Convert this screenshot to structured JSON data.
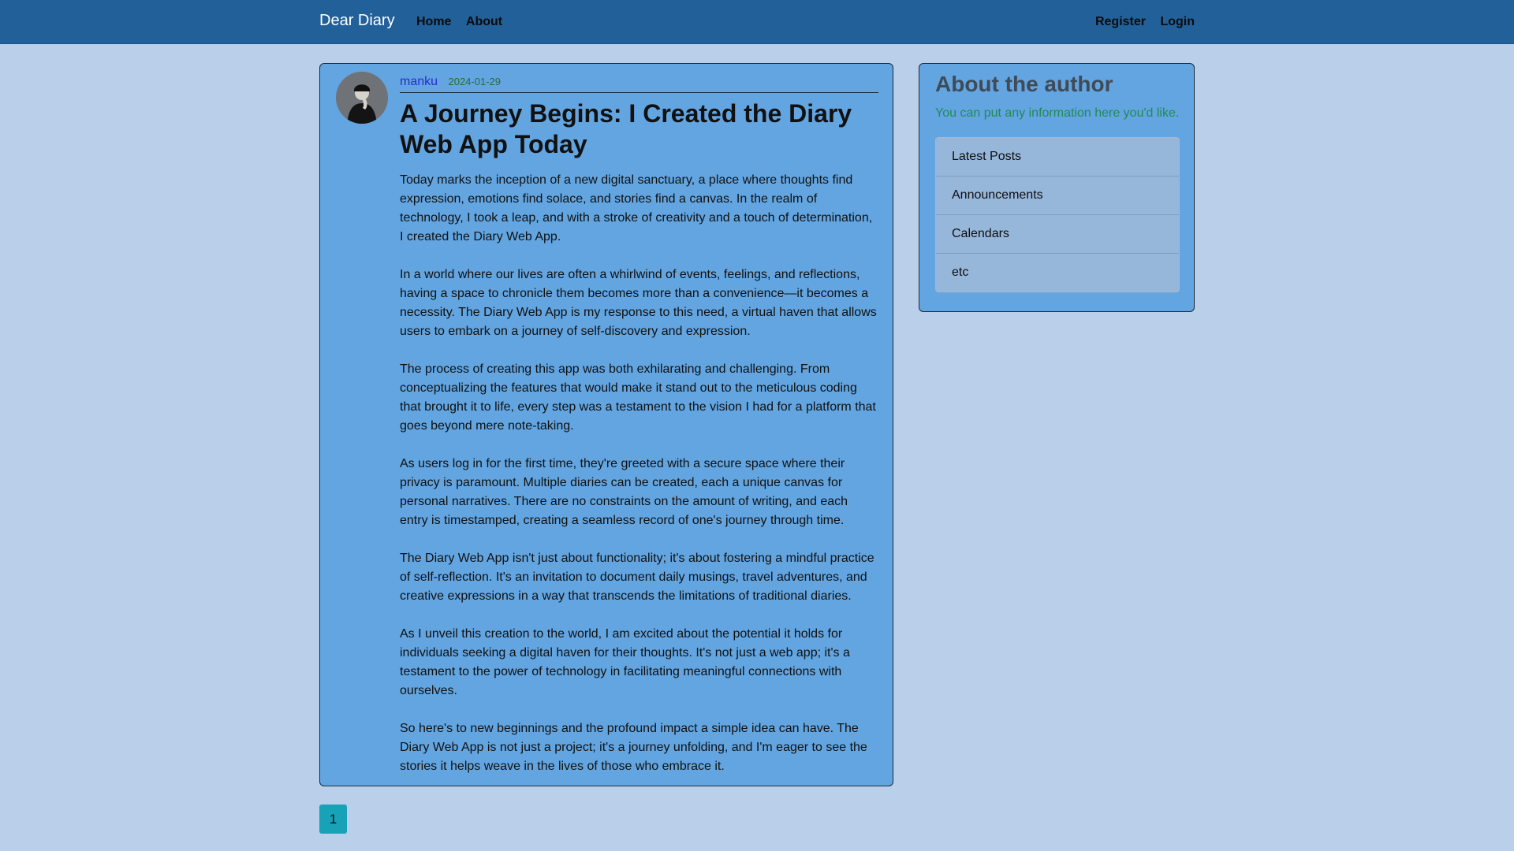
{
  "nav": {
    "brand": "Dear Diary",
    "left_links": [
      "Home",
      "About"
    ],
    "right_links": [
      "Register",
      "Login"
    ]
  },
  "post": {
    "author": "manku",
    "date": "2024-01-29",
    "title": "A Journey Begins: I Created the Diary Web App Today",
    "paragraphs": [
      "Today marks the inception of a new digital sanctuary, a place where thoughts find expression, emotions find solace, and stories find a canvas. In the realm of technology, I took a leap, and with a stroke of creativity and a touch of determination, I created the Diary Web App.",
      "In a world where our lives are often a whirlwind of events, feelings, and reflections, having a space to chronicle them becomes more than a convenience—it becomes a necessity. The Diary Web App is my response to this need, a virtual haven that allows users to embark on a journey of self-discovery and expression.",
      "The process of creating this app was both exhilarating and challenging. From conceptualizing the features that would make it stand out to the meticulous coding that brought it to life, every step was a testament to the vision I had for a platform that goes beyond mere note-taking.",
      "As users log in for the first time, they're greeted with a secure space where their privacy is paramount. Multiple diaries can be created, each a unique canvas for personal narratives. There are no constraints on the amount of writing, and each entry is timestamped, creating a seamless record of one's journey through time.",
      "The Diary Web App isn't just about functionality; it's about fostering a mindful practice of self-reflection. It's an invitation to document daily musings, travel adventures, and creative expressions in a way that transcends the limitations of traditional diaries.",
      "As I unveil this creation to the world, I am excited about the potential it holds for individuals seeking a digital haven for their thoughts. It's not just a web app; it's a testament to the power of technology in facilitating meaningful connections with ourselves.",
      "So here's to new beginnings and the profound impact a simple idea can have. The Diary Web App is not just a project; it's a journey unfolding, and I'm eager to see the stories it helps weave in the lives of those who embrace it."
    ]
  },
  "pagination": {
    "current": "1"
  },
  "sidebar": {
    "title": "About the author",
    "subtitle": "You can put any information here you'd like.",
    "items": [
      "Latest Posts",
      "Announcements",
      "Calendars",
      "etc"
    ]
  },
  "colors": {
    "navbar": "#22609a",
    "page_bg": "#b9cfea",
    "card_bg": "#62a5e1",
    "pager": "#17a2b8",
    "subtitle": "#238a52"
  },
  "icons": {
    "avatar": "user-avatar-image"
  }
}
